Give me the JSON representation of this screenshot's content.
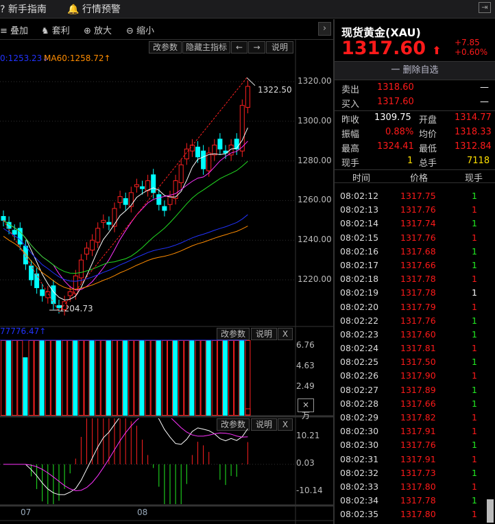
{
  "topbar": {
    "guide": "新手指南",
    "alert": "行情预警"
  },
  "toolbar": {
    "overlay": "叠加",
    "arbitrage": "套利",
    "zoom_in": "放大",
    "zoom_out": "缩小"
  },
  "main_chart": {
    "btn_params": "改参数",
    "btn_hide": "隐藏主指标",
    "btn_left": "←",
    "btn_right": "→",
    "btn_help": "说明",
    "ma_label": "0:1253.23↓",
    "ma60_label": "MA60:1258.72↑",
    "high_label": "1322.50",
    "low_label": "1204.73",
    "y_ticks": [
      "1320.00",
      "1300.00",
      "1280.00",
      "1260.00",
      "1240.00",
      "1220.00"
    ]
  },
  "volume_chart": {
    "label": "77776.47↑",
    "btn_params": "改参数",
    "btn_help": "说明",
    "btn_close": "X",
    "y_ticks": [
      "6.76",
      "4.63",
      "2.49"
    ],
    "unit": "×万"
  },
  "macd_chart": {
    "btn_params": "改参数",
    "btn_help": "说明",
    "btn_close": "X",
    "y_ticks": [
      "10.21",
      "0.03",
      "-10.14"
    ]
  },
  "x_axis": {
    "labels": [
      "07",
      "08"
    ]
  },
  "chart_data": {
    "type": "candlestick",
    "closes": [
      1250,
      1246,
      1243,
      1238,
      1228,
      1220,
      1216,
      1212,
      1214,
      1208,
      1206,
      1209,
      1214,
      1222,
      1230,
      1236,
      1240,
      1246,
      1250,
      1248,
      1256,
      1262,
      1258,
      1264,
      1268,
      1266,
      1270,
      1264,
      1258,
      1255,
      1262,
      1270,
      1278,
      1286,
      1288,
      1282,
      1276,
      1284,
      1288,
      1286,
      1284,
      1288,
      1286,
      1308,
      1317.6
    ]
  },
  "quote": {
    "name": "现货黄金(XAU)",
    "price": "1317.60",
    "change": "+7.85",
    "change_pct": "+0.60%",
    "remove_watch": "一 删除自选",
    "sell_label": "卖出",
    "sell": "1318.60",
    "sell_vol": "—",
    "buy_label": "买入",
    "buy": "1317.60",
    "buy_vol": "—",
    "prev_close_label": "昨收",
    "prev_close": "1309.75",
    "open_label": "开盘",
    "open": "1314.77",
    "amp_label": "振幅",
    "amp": "0.88%",
    "avg_label": "均价",
    "avg": "1318.33",
    "high_label": "最高",
    "high": "1324.41",
    "low_label": "最低",
    "low": "1312.84",
    "cur_vol_label": "现手",
    "cur_vol": "1",
    "total_vol_label": "总手",
    "total_vol": "7118"
  },
  "ticks_header": {
    "time": "时间",
    "price": "价格",
    "vol": "现手"
  },
  "ticks": [
    {
      "t": "08:02:12",
      "p": "1317.75",
      "v": "1",
      "c": "g"
    },
    {
      "t": "08:02:13",
      "p": "1317.76",
      "v": "1",
      "c": "r"
    },
    {
      "t": "08:02:14",
      "p": "1317.74",
      "v": "1",
      "c": "g"
    },
    {
      "t": "08:02:15",
      "p": "1317.76",
      "v": "1",
      "c": "r"
    },
    {
      "t": "08:02:16",
      "p": "1317.68",
      "v": "1",
      "c": "g"
    },
    {
      "t": "08:02:17",
      "p": "1317.66",
      "v": "1",
      "c": "g"
    },
    {
      "t": "08:02:18",
      "p": "1317.78",
      "v": "1",
      "c": "r"
    },
    {
      "t": "08:02:19",
      "p": "1317.78",
      "v": "1",
      "c": "w"
    },
    {
      "t": "08:02:20",
      "p": "1317.79",
      "v": "1",
      "c": "r"
    },
    {
      "t": "08:02:22",
      "p": "1317.76",
      "v": "1",
      "c": "g"
    },
    {
      "t": "08:02:23",
      "p": "1317.60",
      "v": "1",
      "c": "g"
    },
    {
      "t": "08:02:24",
      "p": "1317.81",
      "v": "1",
      "c": "r"
    },
    {
      "t": "08:02:25",
      "p": "1317.50",
      "v": "1",
      "c": "g"
    },
    {
      "t": "08:02:26",
      "p": "1317.90",
      "v": "1",
      "c": "r"
    },
    {
      "t": "08:02:27",
      "p": "1317.89",
      "v": "1",
      "c": "g"
    },
    {
      "t": "08:02:28",
      "p": "1317.66",
      "v": "1",
      "c": "g"
    },
    {
      "t": "08:02:29",
      "p": "1317.82",
      "v": "1",
      "c": "r"
    },
    {
      "t": "08:02:30",
      "p": "1317.91",
      "v": "1",
      "c": "r"
    },
    {
      "t": "08:02:30",
      "p": "1317.76",
      "v": "1",
      "c": "g"
    },
    {
      "t": "08:02:31",
      "p": "1317.91",
      "v": "1",
      "c": "r"
    },
    {
      "t": "08:02:32",
      "p": "1317.73",
      "v": "1",
      "c": "g"
    },
    {
      "t": "08:02:33",
      "p": "1317.80",
      "v": "1",
      "c": "r"
    },
    {
      "t": "08:02:34",
      "p": "1317.78",
      "v": "1",
      "c": "g"
    },
    {
      "t": "08:02:35",
      "p": "1317.80",
      "v": "1",
      "c": "r"
    }
  ]
}
